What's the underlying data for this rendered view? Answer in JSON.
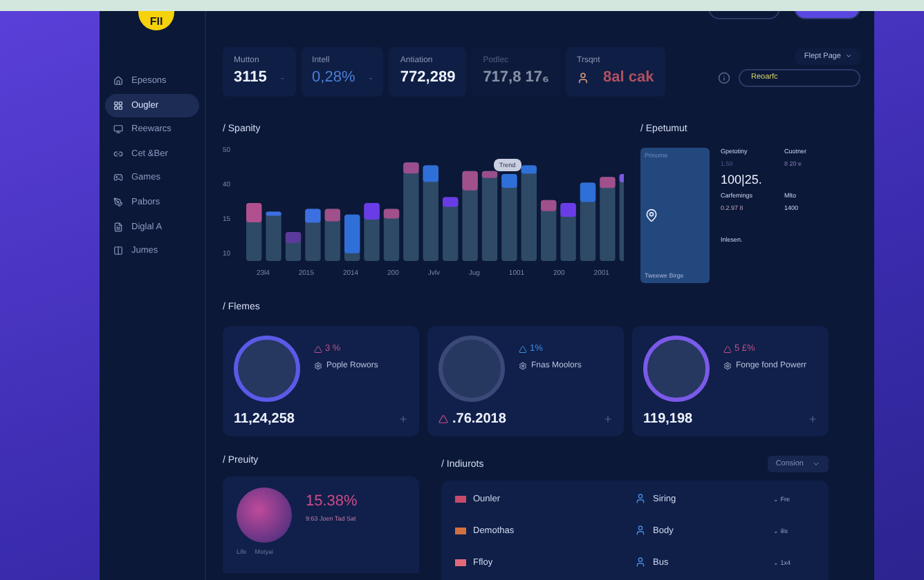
{
  "logo": {
    "text": "FII"
  },
  "sidebar": {
    "items": [
      {
        "label": "Epesons",
        "selected": false
      },
      {
        "label": "Ougler",
        "selected": true
      },
      {
        "label": "Reewarcs",
        "selected": false
      },
      {
        "label": "Cet &Ber",
        "selected": false
      },
      {
        "label": "Games",
        "selected": false
      },
      {
        "label": "Pabors",
        "selected": false
      },
      {
        "label": "Diglal A",
        "selected": false
      },
      {
        "label": "Jumes",
        "selected": false
      }
    ]
  },
  "stats": [
    {
      "label": "Mutton",
      "value": "3115",
      "trend": "-",
      "kind": "normal"
    },
    {
      "label": "Intell",
      "value": "0,28%",
      "trend": "-",
      "kind": "accent"
    },
    {
      "label": "Antiation",
      "value": "772,289",
      "kind": "normal"
    },
    {
      "label": "Podlec",
      "value": "717,8 17₆",
      "kind": "faded"
    },
    {
      "label": "Trsqnt",
      "value": "8al cak",
      "kind": "avatar"
    }
  ],
  "page_select": {
    "value": "Flept Page"
  },
  "search": {
    "value": "Reoarfc"
  },
  "activity": {
    "title": "/ Spanity",
    "y_labels": [
      "50",
      "40",
      "15",
      "10"
    ],
    "x_labels": [
      "23l4",
      "2015",
      "2014",
      "200",
      "Jvlv",
      "Jug",
      "1001",
      "200",
      "2001"
    ],
    "tooltip": "Trend"
  },
  "overview": {
    "title": "/ Epetumut",
    "map_label": "Prinome",
    "map_caption": "Tweewe Birge",
    "col_1_label": "Gpetotiny",
    "col_1_reading": "1.58",
    "col_2_label": "Cuotner",
    "col_2_reading": "8 20 e",
    "big_value": "100|25.",
    "col_3_label": "Carfemings",
    "col_3_reading": "0.2.97 8",
    "col_4_label": "Mlto",
    "col_4_reading": "1400",
    "footer": "Inlesen."
  },
  "flames": {
    "title": "/ Flemes",
    "cards": [
      {
        "change": "3 %",
        "color": "#c0508a",
        "label": "Pople Rowors",
        "value": "11,24,258",
        "value_mark": false
      },
      {
        "change": "1%",
        "color": "#3f8ee8",
        "label": "Fnas Moolors",
        "value": ".76.2018",
        "value_mark": true
      },
      {
        "change": "5 £%",
        "color": "#c0508a",
        "label": "Fonge fond Powerr",
        "value": "119,198",
        "value_mark": false
      }
    ]
  },
  "profile": {
    "title": "/ Preuity",
    "percent": "15.38%",
    "detail": "9:63 Joen Tad Sat",
    "footer_1": "Life",
    "footer_2": "Motyai"
  },
  "indicators": {
    "title": "/ Indiurots",
    "filter": "Consion",
    "rows": [
      {
        "name": "Ounler",
        "color": "#c84a6a",
        "item": "Siring",
        "note": "⌄ Fre"
      },
      {
        "name": "Demothas",
        "color": "#d07040",
        "item": "Body",
        "note": "⌄ ilis"
      },
      {
        "name": "Ffloy",
        "color": "#e06a7a",
        "item": "Bus",
        "note": "⌄ 1x4"
      }
    ]
  }
}
